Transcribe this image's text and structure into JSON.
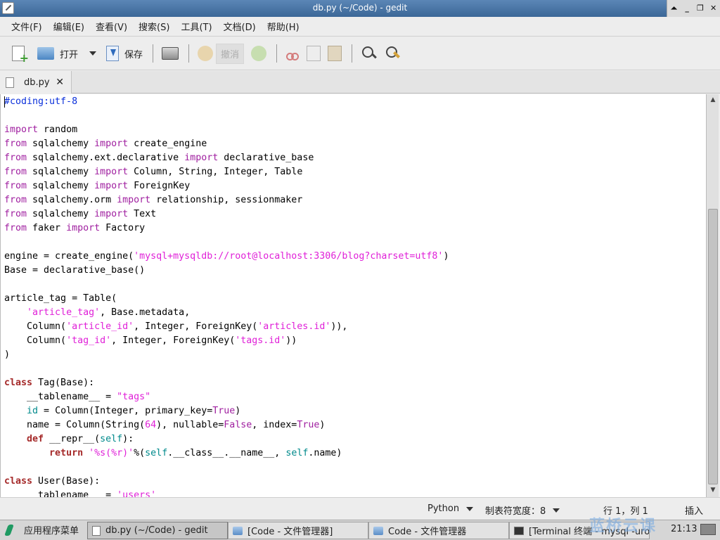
{
  "window": {
    "title": "db.py (~/Code) - gedit",
    "buttons": [
      "⏶",
      "_",
      "❐",
      "✕"
    ]
  },
  "menu": [
    "文件(F)",
    "编辑(E)",
    "查看(V)",
    "搜索(S)",
    "工具(T)",
    "文档(D)",
    "帮助(H)"
  ],
  "toolbar": {
    "open_label": "打开",
    "save_label": "保存",
    "undo_label": "撤消"
  },
  "tab": {
    "name": "db.py",
    "close": "✕"
  },
  "editor": {
    "lines": [
      [
        [
          "comment",
          "#coding:utf-8"
        ]
      ],
      [],
      [
        [
          "kw",
          "import"
        ],
        [
          "",
          " random"
        ]
      ],
      [
        [
          "kw",
          "from"
        ],
        [
          "",
          " sqlalchemy "
        ],
        [
          "kw",
          "import"
        ],
        [
          "",
          " create_engine"
        ]
      ],
      [
        [
          "kw",
          "from"
        ],
        [
          "",
          " sqlalchemy.ext.declarative "
        ],
        [
          "kw",
          "import"
        ],
        [
          "",
          " declarative_base"
        ]
      ],
      [
        [
          "kw",
          "from"
        ],
        [
          "",
          " sqlalchemy "
        ],
        [
          "kw",
          "import"
        ],
        [
          "",
          " Column, String, Integer, Table"
        ]
      ],
      [
        [
          "kw",
          "from"
        ],
        [
          "",
          " sqlalchemy "
        ],
        [
          "kw",
          "import"
        ],
        [
          "",
          " ForeignKey"
        ]
      ],
      [
        [
          "kw",
          "from"
        ],
        [
          "",
          " sqlalchemy.orm "
        ],
        [
          "kw",
          "import"
        ],
        [
          "",
          " relationship, sessionmaker"
        ]
      ],
      [
        [
          "kw",
          "from"
        ],
        [
          "",
          " sqlalchemy "
        ],
        [
          "kw",
          "import"
        ],
        [
          "",
          " Text"
        ]
      ],
      [
        [
          "kw",
          "from"
        ],
        [
          "",
          " faker "
        ],
        [
          "kw",
          "import"
        ],
        [
          "",
          " Factory"
        ]
      ],
      [],
      [
        [
          "",
          "engine = create_engine("
        ],
        [
          "str",
          "'mysql+mysqldb://root@localhost:3306/blog?charset=utf8'"
        ],
        [
          "",
          ")"
        ]
      ],
      [
        [
          "",
          "Base = declarative_base()"
        ]
      ],
      [],
      [
        [
          "",
          "article_tag = Table("
        ]
      ],
      [
        [
          "",
          "    "
        ],
        [
          "str",
          "'article_tag'"
        ],
        [
          "",
          ", Base.metadata,"
        ]
      ],
      [
        [
          "",
          "    Column("
        ],
        [
          "str",
          "'article_id'"
        ],
        [
          "",
          ", Integer, ForeignKey("
        ],
        [
          "str",
          "'articles.id'"
        ],
        [
          "",
          ")),"
        ]
      ],
      [
        [
          "",
          "    Column("
        ],
        [
          "str",
          "'tag_id'"
        ],
        [
          "",
          ", Integer, ForeignKey("
        ],
        [
          "str",
          "'tags.id'"
        ],
        [
          "",
          "))"
        ]
      ],
      [
        [
          "",
          ")"
        ]
      ],
      [],
      [
        [
          "kwc",
          "class"
        ],
        [
          "",
          " Tag(Base):"
        ]
      ],
      [
        [
          "",
          "    __tablename__ = "
        ],
        [
          "str",
          "\"tags\""
        ]
      ],
      [
        [
          "",
          "    "
        ],
        [
          "bi",
          "id"
        ],
        [
          "",
          " = Column(Integer, primary_key="
        ],
        [
          "kw",
          "True"
        ],
        [
          "",
          ")"
        ]
      ],
      [
        [
          "",
          "    name = Column(String("
        ],
        [
          "num",
          "64"
        ],
        [
          "",
          "), nullable="
        ],
        [
          "kw",
          "False"
        ],
        [
          "",
          ", index="
        ],
        [
          "kw",
          "True"
        ],
        [
          "",
          ")"
        ]
      ],
      [
        [
          "",
          "    "
        ],
        [
          "kwc",
          "def"
        ],
        [
          "",
          " __repr__("
        ],
        [
          "bi",
          "self"
        ],
        [
          "",
          "):"
        ]
      ],
      [
        [
          "",
          "        "
        ],
        [
          "kwc",
          "return"
        ],
        [
          "",
          " "
        ],
        [
          "str",
          "'%s(%r)'"
        ],
        [
          "",
          "%("
        ],
        [
          "bi",
          "self"
        ],
        [
          "",
          ".__class__.__name__, "
        ],
        [
          "bi",
          "self"
        ],
        [
          "",
          ".name)"
        ]
      ],
      [],
      [
        [
          "kwc",
          "class"
        ],
        [
          "",
          " User(Base):"
        ]
      ],
      [
        [
          "",
          "    __tablename__ = "
        ],
        [
          "str",
          "'users'"
        ]
      ]
    ]
  },
  "statusbar": {
    "language": "Python",
    "tab_width": "制表符宽度：8",
    "position": "行 1，列 1",
    "mode": "插入"
  },
  "taskbar": {
    "start_label": "应用程序菜单",
    "tasks": [
      {
        "label": "db.py (~/Code) - gedit",
        "icon": "gedit-icon",
        "active": true
      },
      {
        "label": "[Code - 文件管理器]",
        "icon": "folder-icon",
        "active": false
      },
      {
        "label": "Code - 文件管理器",
        "icon": "folder-icon",
        "active": false
      },
      {
        "label": "[Terminal 终端 - mysql -uro…",
        "icon": "terminal-icon",
        "active": false
      }
    ],
    "watermark": "蓝桥云课",
    "clock": "21:13"
  }
}
